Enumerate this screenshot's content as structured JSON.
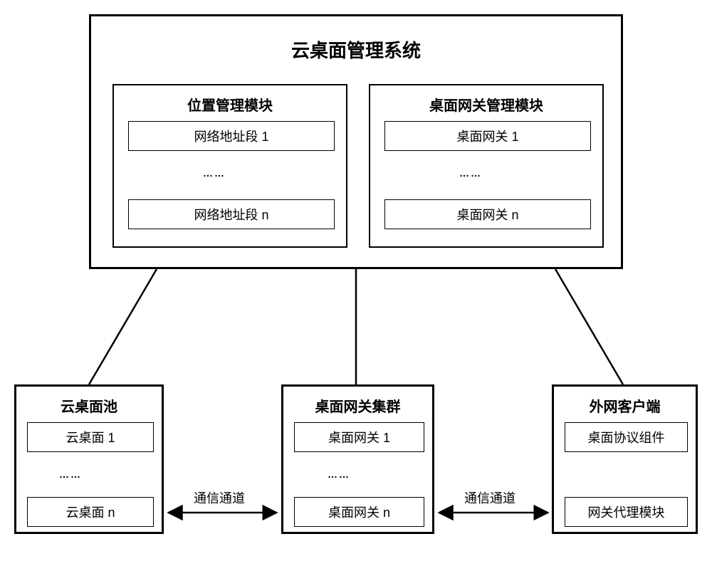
{
  "mgmt": {
    "title": "云桌面管理系统",
    "location_module": {
      "title": "位置管理模块",
      "item_first": "网络地址段 1",
      "ellipsis": "……",
      "item_last": "网络地址段 n"
    },
    "gateway_module": {
      "title": "桌面网关管理模块",
      "item_first": "桌面网关 1",
      "ellipsis": "……",
      "item_last": "桌面网关 n"
    }
  },
  "pool": {
    "title": "云桌面池",
    "item_first": "云桌面 1",
    "ellipsis": "……",
    "item_last": "云桌面 n"
  },
  "cluster": {
    "title": "桌面网关集群",
    "item_first": "桌面网关 1",
    "ellipsis": "……",
    "item_last": "桌面网关 n"
  },
  "client": {
    "title": "外网客户端",
    "protocol_component": "桌面协议组件",
    "proxy_module": "网关代理模块"
  },
  "channels": {
    "left": "通信通道",
    "right": "通信通道"
  }
}
